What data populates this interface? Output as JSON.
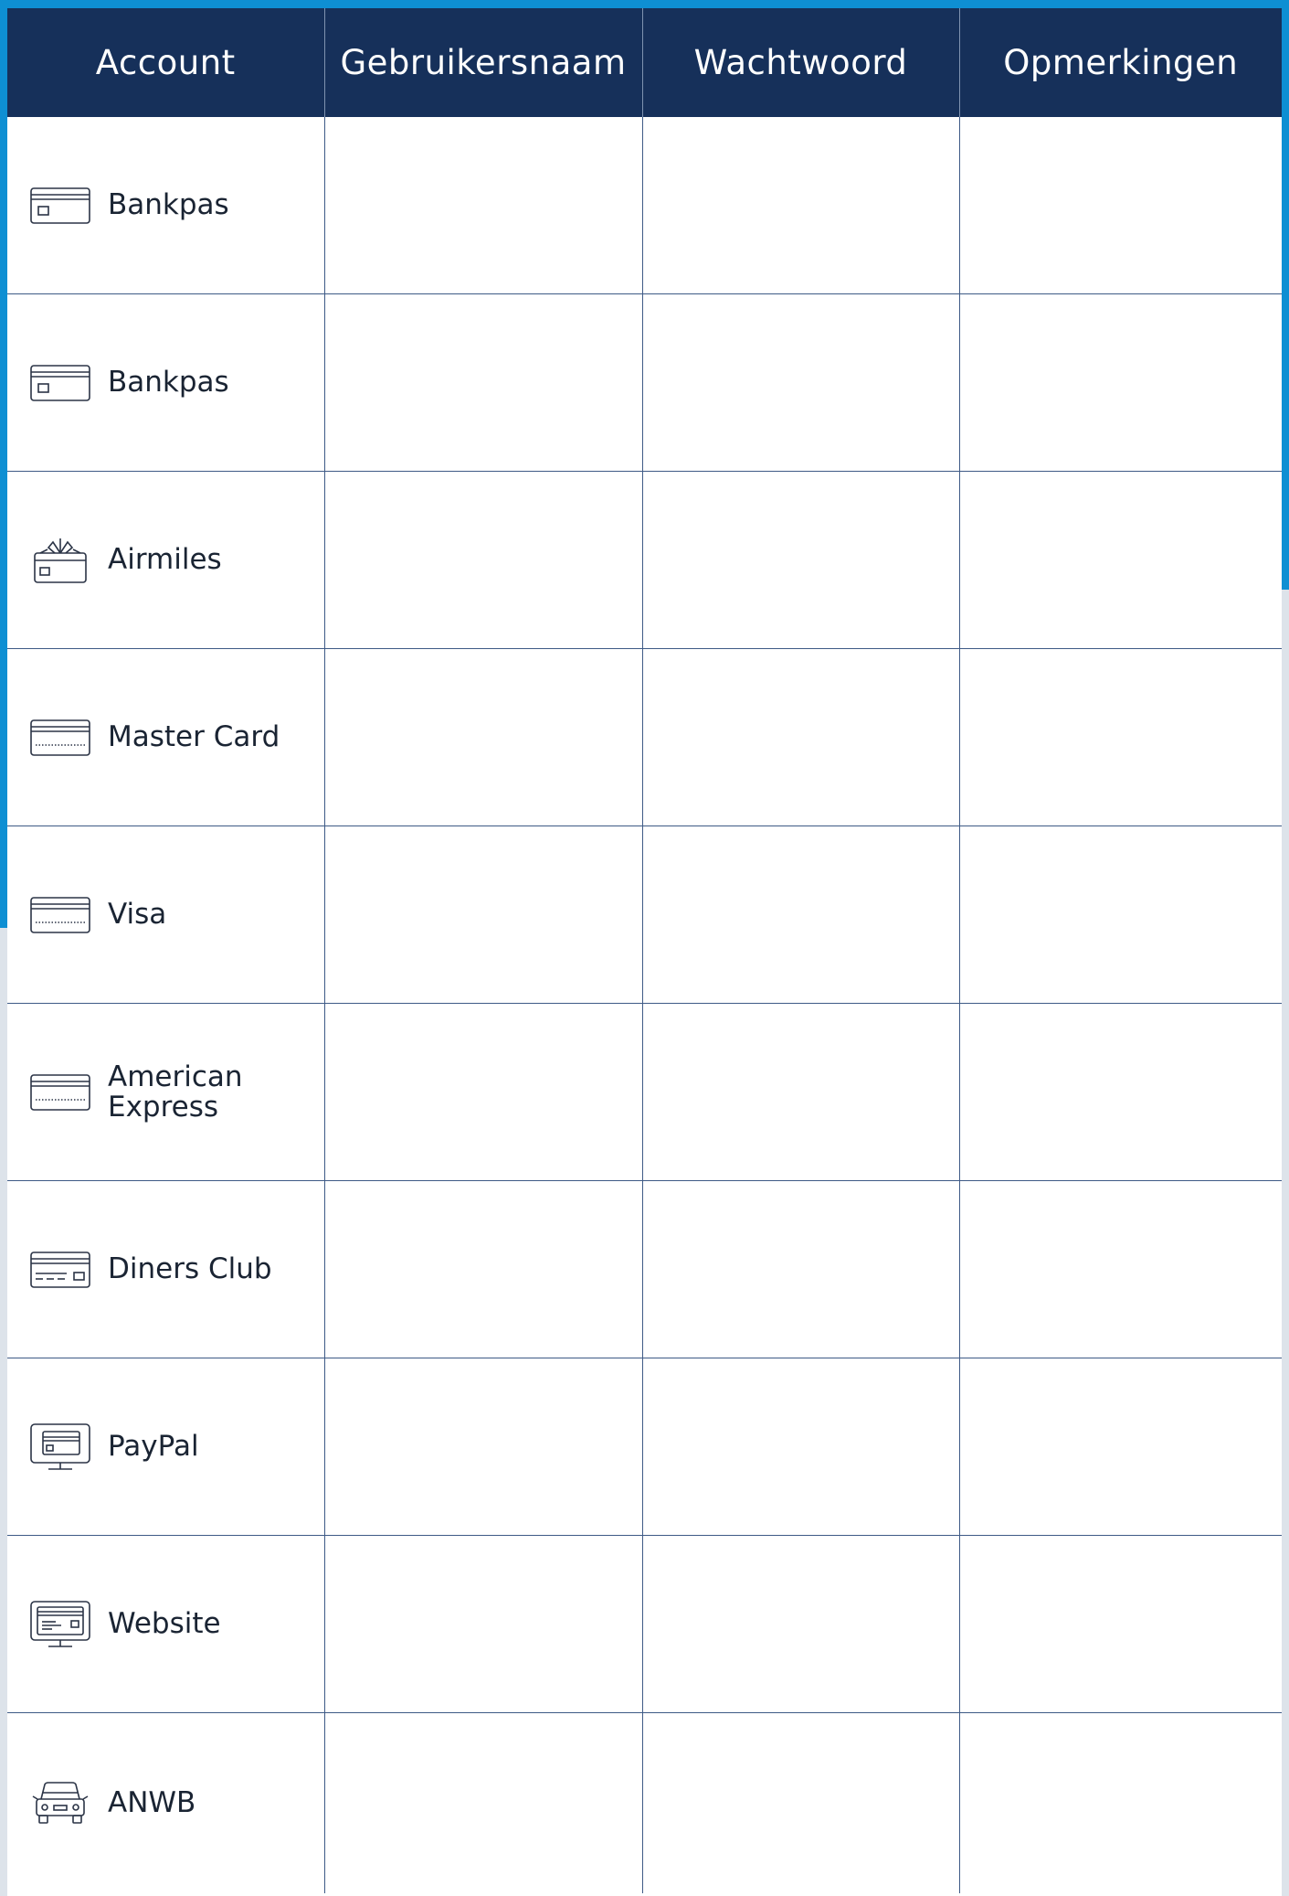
{
  "header": {
    "columns": [
      "Account",
      "Gebruikersnaam",
      "Wachtwoord",
      "Opmerkingen"
    ]
  },
  "rows": [
    {
      "account": "Bankpas",
      "icon": "bank-card-icon"
    },
    {
      "account": "Bankpas",
      "icon": "bank-card-icon"
    },
    {
      "account": "Airmiles",
      "icon": "gift-card-icon"
    },
    {
      "account": "Master Card",
      "icon": "credit-card-icon"
    },
    {
      "account": "Visa",
      "icon": "credit-card-icon"
    },
    {
      "account": "American Express",
      "icon": "credit-card-icon"
    },
    {
      "account": "Diners Club",
      "icon": "payment-card-icon"
    },
    {
      "account": "PayPal",
      "icon": "monitor-card-icon"
    },
    {
      "account": "Website",
      "icon": "monitor-web-icon"
    },
    {
      "account": "ANWB",
      "icon": "car-icon"
    }
  ],
  "colors": {
    "header_bg": "#16305a",
    "accent_blue": "#0e8fd3",
    "grid_line": "#3e5a86"
  }
}
